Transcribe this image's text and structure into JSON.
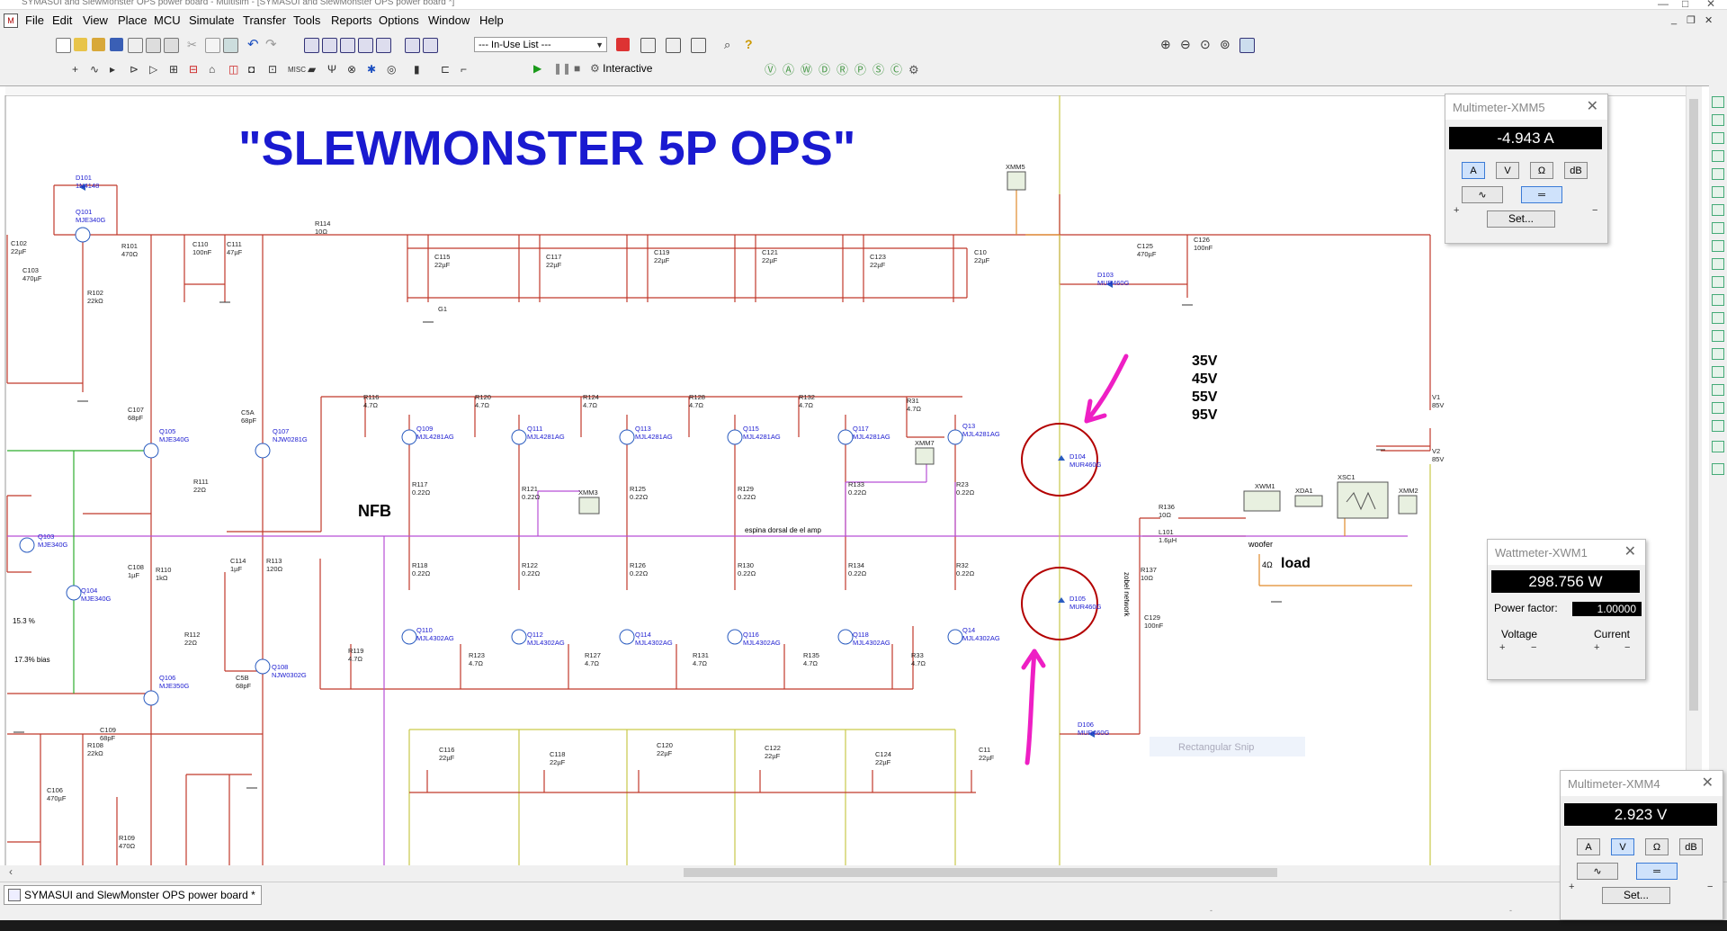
{
  "window": {
    "title": "SYMASUI and SlewMonster OPS power board - Multisim - [SYMASUI and SlewMonster OPS power board *]"
  },
  "menu": [
    "File",
    "Edit",
    "View",
    "Place",
    "MCU",
    "Simulate",
    "Transfer",
    "Tools",
    "Reports",
    "Options",
    "Window",
    "Help"
  ],
  "toolbar": {
    "in_use_list": "--- In-Use List ---",
    "interactive_label": "Interactive"
  },
  "schematic": {
    "title": "\"SLEWMONSTER 5P OPS\"",
    "nfb": "NFB",
    "voltages": [
      "35V",
      "45V",
      "55V",
      "95V"
    ],
    "load": "load",
    "woofer": "woofer",
    "load_r": "4Ω",
    "bus_label": "espina dorsal de el amp",
    "zobel": "zobel network",
    "pct1": "15.3 %",
    "pct2": "17.3% bias",
    "snip": "Rectangular Snip",
    "components": [
      {
        "ref": "D101",
        "val": "1N4148"
      },
      {
        "ref": "Q101",
        "val": "MJE340G"
      },
      {
        "ref": "C102",
        "val": "22µF"
      },
      {
        "ref": "R101",
        "val": "470Ω"
      },
      {
        "ref": "C103",
        "val": "470µF"
      },
      {
        "ref": "R102",
        "val": "22kΩ"
      },
      {
        "ref": "C110",
        "val": "100nF"
      },
      {
        "ref": "C111",
        "val": "47µF"
      },
      {
        "ref": "R114",
        "val": "10Ω"
      },
      {
        "ref": "C115",
        "val": "22µF"
      },
      {
        "ref": "C117",
        "val": "22µF"
      },
      {
        "ref": "C119",
        "val": "22µF"
      },
      {
        "ref": "C121",
        "val": "22µF"
      },
      {
        "ref": "C123",
        "val": "22µF"
      },
      {
        "ref": "C10",
        "val": "22µF"
      },
      {
        "ref": "G1",
        "val": ""
      },
      {
        "ref": "C125",
        "val": "470µF"
      },
      {
        "ref": "C126",
        "val": "100nF"
      },
      {
        "ref": "D103",
        "val": "MUR460G"
      },
      {
        "ref": "R116",
        "val": "4.7Ω"
      },
      {
        "ref": "R120",
        "val": "4.7Ω"
      },
      {
        "ref": "R124",
        "val": "4.7Ω"
      },
      {
        "ref": "R128",
        "val": "4.7Ω"
      },
      {
        "ref": "R132",
        "val": "4.7Ω"
      },
      {
        "ref": "R31",
        "val": "4.7Ω"
      },
      {
        "ref": "Q109",
        "val": "MJL4281AG"
      },
      {
        "ref": "Q111",
        "val": "MJL4281AG"
      },
      {
        "ref": "Q113",
        "val": "MJL4281AG"
      },
      {
        "ref": "Q115",
        "val": "MJL4281AG"
      },
      {
        "ref": "Q117",
        "val": "MJL4281AG"
      },
      {
        "ref": "Q13",
        "val": "MJL4281AG"
      },
      {
        "ref": "C107",
        "val": "68pF"
      },
      {
        "ref": "Q105",
        "val": "MJE340G"
      },
      {
        "ref": "C5A",
        "val": "68pF"
      },
      {
        "ref": "Q107",
        "val": "NJW0281G"
      },
      {
        "ref": "R111",
        "val": "22Ω"
      },
      {
        "ref": "R117",
        "val": "0.22Ω"
      },
      {
        "ref": "R121",
        "val": "0.22Ω"
      },
      {
        "ref": "R125",
        "val": "0.22Ω"
      },
      {
        "ref": "R129",
        "val": "0.22Ω"
      },
      {
        "ref": "R133",
        "val": "0.22Ω"
      },
      {
        "ref": "R23",
        "val": "0.22Ω"
      },
      {
        "ref": "D104",
        "val": "MUR460G"
      },
      {
        "ref": "D105",
        "val": "MUR460G"
      },
      {
        "ref": "Q103",
        "val": "MJE340G"
      },
      {
        "ref": "Q104",
        "val": "MJE340G"
      },
      {
        "ref": "C108",
        "val": "1µF"
      },
      {
        "ref": "R110",
        "val": "1kΩ"
      },
      {
        "ref": "C114",
        "val": "1µF"
      },
      {
        "ref": "R113",
        "val": "120Ω"
      },
      {
        "ref": "R118",
        "val": "0.22Ω"
      },
      {
        "ref": "R122",
        "val": "0.22Ω"
      },
      {
        "ref": "R126",
        "val": "0.22Ω"
      },
      {
        "ref": "R130",
        "val": "0.22Ω"
      },
      {
        "ref": "R134",
        "val": "0.22Ω"
      },
      {
        "ref": "R32",
        "val": "0.22Ω"
      },
      {
        "ref": "R136",
        "val": "10Ω"
      },
      {
        "ref": "L101",
        "val": "1.6µH"
      },
      {
        "ref": "R137",
        "val": "10Ω"
      },
      {
        "ref": "C129",
        "val": "100nF"
      },
      {
        "ref": "Q110",
        "val": "MJL4302AG"
      },
      {
        "ref": "Q112",
        "val": "MJL4302AG"
      },
      {
        "ref": "Q114",
        "val": "MJL4302AG"
      },
      {
        "ref": "Q116",
        "val": "MJL4302AG"
      },
      {
        "ref": "Q118",
        "val": "MJL4302AG"
      },
      {
        "ref": "Q14",
        "val": "MJL4302AG"
      },
      {
        "ref": "R119",
        "val": "4.7Ω"
      },
      {
        "ref": "R123",
        "val": "4.7Ω"
      },
      {
        "ref": "R127",
        "val": "4.7Ω"
      },
      {
        "ref": "R131",
        "val": "4.7Ω"
      },
      {
        "ref": "R135",
        "val": "4.7Ω"
      },
      {
        "ref": "R33",
        "val": "4.7Ω"
      },
      {
        "ref": "R112",
        "val": "22Ω"
      },
      {
        "ref": "Q108",
        "val": "NJW0302G"
      },
      {
        "ref": "Q106",
        "val": "MJE350G"
      },
      {
        "ref": "C5B",
        "val": "68pF"
      },
      {
        "ref": "C109",
        "val": "68pF"
      },
      {
        "ref": "R108",
        "val": "22kΩ"
      },
      {
        "ref": "C106",
        "val": "470µF"
      },
      {
        "ref": "R109",
        "val": "470Ω"
      },
      {
        "ref": "C116",
        "val": "22µF"
      },
      {
        "ref": "C118",
        "val": "22µF"
      },
      {
        "ref": "C120",
        "val": "22µF"
      },
      {
        "ref": "C122",
        "val": "22µF"
      },
      {
        "ref": "C124",
        "val": "22µF"
      },
      {
        "ref": "C11",
        "val": "22µF"
      },
      {
        "ref": "D106",
        "val": "MUR460G"
      },
      {
        "ref": "V1",
        "val": "85V"
      },
      {
        "ref": "V2",
        "val": "85V"
      },
      {
        "ref": "XMM5",
        "val": ""
      },
      {
        "ref": "XMM7",
        "val": ""
      },
      {
        "ref": "XMM3",
        "val": ""
      },
      {
        "ref": "XWM1",
        "val": ""
      },
      {
        "ref": "XDA1",
        "val": ""
      },
      {
        "ref": "XSC1",
        "val": ""
      },
      {
        "ref": "XMM2",
        "val": ""
      }
    ]
  },
  "xmm5": {
    "title": "Multimeter-XMM5",
    "reading": "-4.943 A",
    "buttons": [
      "A",
      "V",
      "Ω",
      "dB"
    ],
    "selected": "A",
    "set": "Set...",
    "plus": "+",
    "minus": "−"
  },
  "xwm1": {
    "title": "Wattmeter-XWM1",
    "reading": "298.756 W",
    "pf_label": "Power factor:",
    "pf_value": "1.00000",
    "voltage": "Voltage",
    "current": "Current",
    "plus": "+",
    "minus": "−"
  },
  "xmm4": {
    "title": "Multimeter-XMM4",
    "reading": "2.923 V",
    "buttons": [
      "A",
      "V",
      "Ω",
      "dB"
    ],
    "selected": "V",
    "set": "Set...",
    "plus": "+",
    "minus": "−"
  },
  "tabs": {
    "doc": "SYMASUI and SlewMonster OPS power board *"
  },
  "colors": {
    "wire_red": "#c0392b",
    "wire_purple": "#b84fd6",
    "wire_yellow": "#c9c94a",
    "wire_green": "#2eae2e",
    "wire_orange": "#e08a2a",
    "title_blue": "#1a1ad0",
    "annot_magenta": "#ee1fc4",
    "highlight_circle": "#b30000"
  }
}
